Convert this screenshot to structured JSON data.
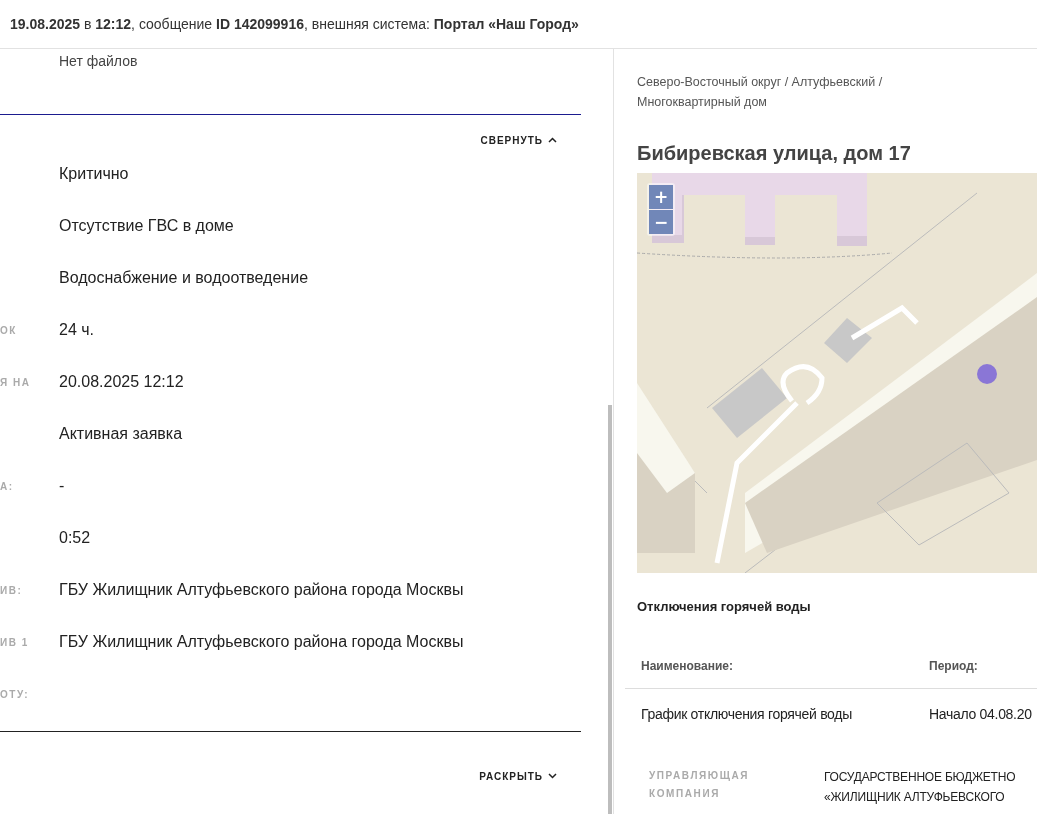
{
  "header": {
    "text": "**19.08.2025** в **12:12**, сообщение **ID 142099916**, внешняя система: **Портал «Наш Город»**"
  },
  "files": {
    "empty_text": "Нет файлов"
  },
  "details": {
    "toggle": {
      "label": "СВЕРНУТЬ",
      "expanded": true
    },
    "rows": [
      {
        "label": "",
        "value": "Критично"
      },
      {
        "label": "",
        "value": "Отсутствие ГВС в доме"
      },
      {
        "label": "",
        "value": "Водоснабжение и водоотведение"
      },
      {
        "label": "ОК",
        "value": "24 ч."
      },
      {
        "label": "Я НА",
        "value": "20.08.2025 12:12"
      },
      {
        "label": "",
        "value": "Активная заявка"
      },
      {
        "label": "А:",
        "value": "-"
      },
      {
        "label": "",
        "value": "0:52"
      },
      {
        "label": "ИВ:",
        "value": "ГБУ Жилищник Алтуфьевского района города Москвы"
      },
      {
        "label": "ИВ 1",
        "value": "ГБУ Жилищник Алтуфьевского района города Москвы"
      },
      {
        "label": "ОТУ:",
        "value": ""
      }
    ]
  },
  "more": {
    "toggle": {
      "label": "РАСКРЫТЬ",
      "expanded": false
    }
  },
  "address": {
    "breadcrumb_lines": [
      "Северо-Восточный округ / Алтуфьевский /",
      "Многоквартирный дом"
    ],
    "title": "Бибиревская улица, дом 17"
  },
  "map": {
    "zoom_in": "+",
    "zoom_out": "−"
  },
  "outages": {
    "title": "Отключения горячей воды",
    "columns": [
      "Наименование:",
      "Период:"
    ],
    "rows": [
      [
        "График отключения горячей воды",
        "Начало 04.08.20"
      ]
    ]
  },
  "company": {
    "label": "УПРАВЛЯЮЩАЯ КОМПАНИЯ",
    "value_lines": [
      "ГОСУДАРСТВЕННОЕ БЮДЖЕТНО",
      "«ЖИЛИЩНИК АЛТУФЬЕВСКОГО"
    ]
  }
}
